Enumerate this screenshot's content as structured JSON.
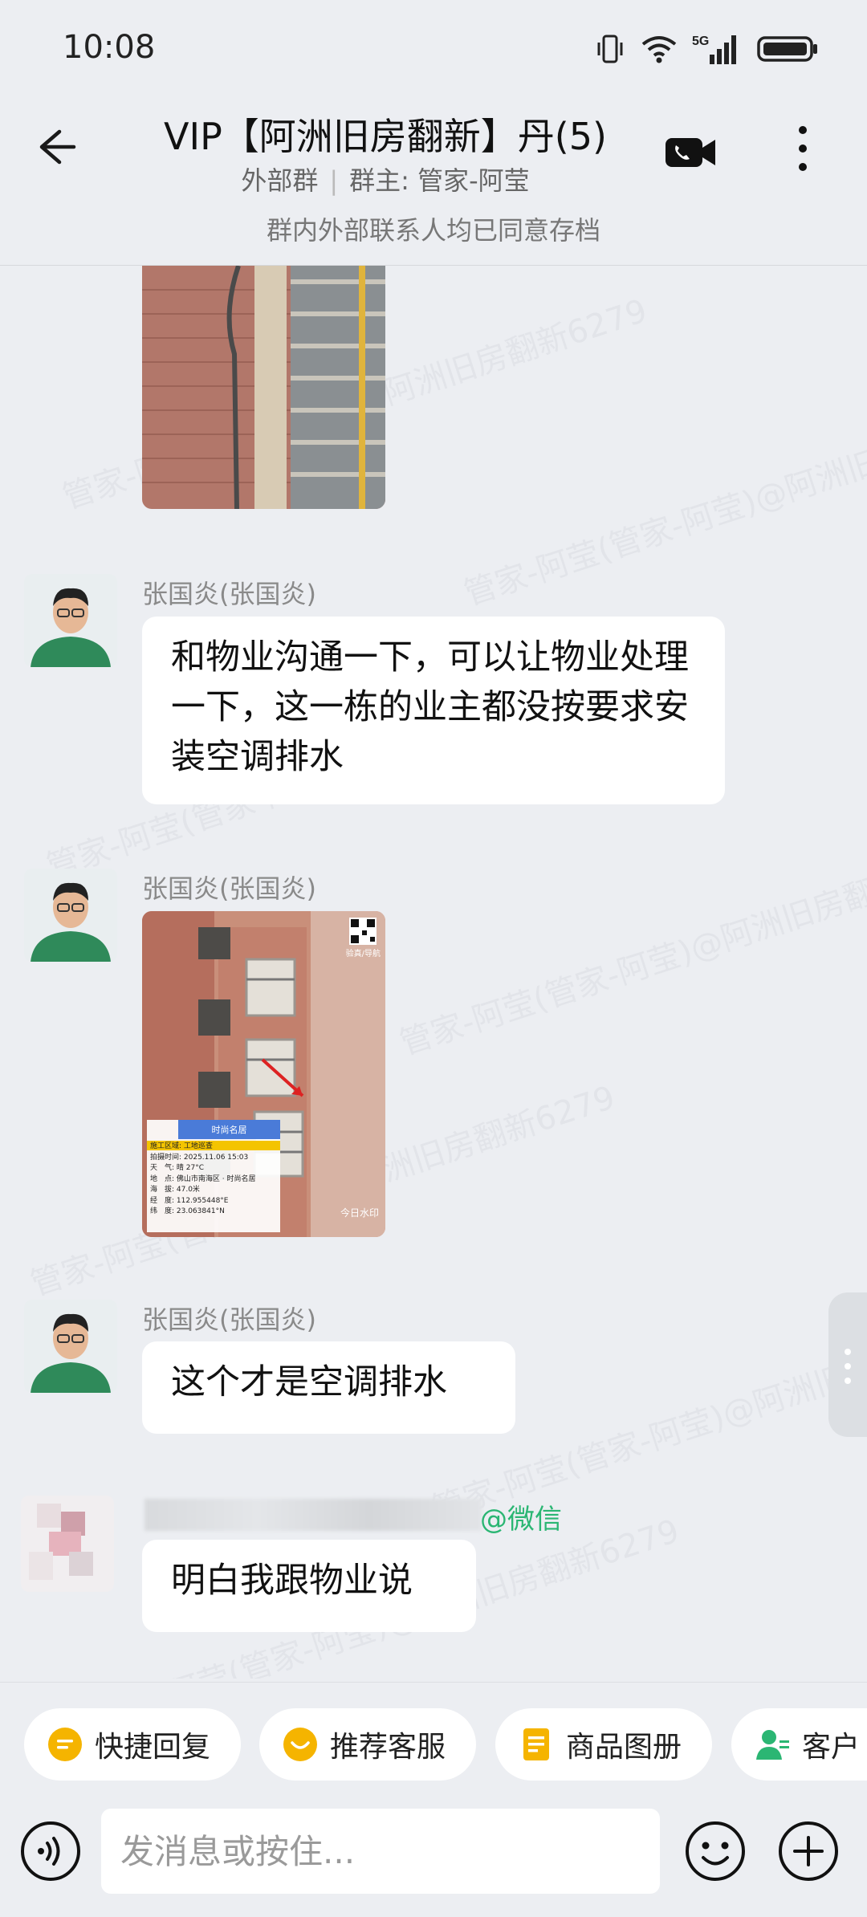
{
  "status": {
    "time": "10:08",
    "network": "5G"
  },
  "header": {
    "title": "VIP【阿洲旧房翻新】丹(5)",
    "group_type": "外部群",
    "owner": "群主: 管家-阿莹"
  },
  "notice": "群内外部联系人均已同意存档",
  "watermark_text": "管家-阿莹(管家-阿莹)@阿洲旧房翻新6279",
  "messages": [
    {
      "sender": "张国炎(张国炎)",
      "text": "和物业沟通一下，可以让物业处理一下，这一栋的业主都没按要求安装空调排水"
    },
    {
      "sender": "张国炎(张国炎)",
      "photo_caption": "时尚名居",
      "photo_info": [
        "施工区域: 工地巡查",
        "拍摄时间: 2025.11.06 15:03",
        "天　气: 晴 27°C",
        "地　点: 佛山市南海区 · 时尚名居",
        "海　拔: 47.0米",
        "经　度: 112.955448°E",
        "纬　度: 23.063841°N"
      ],
      "photo_badge": "今日水印",
      "qr_label": "验真/导航"
    },
    {
      "sender": "张国炎(张国炎)",
      "text": "这个才是空调排水"
    },
    {
      "sender_suffix": "@微信",
      "text": "明白我跟物业说"
    }
  ],
  "quick_replies": [
    {
      "label": "快捷回复",
      "icon": "reply-icon"
    },
    {
      "label": "推荐客服",
      "icon": "service-icon"
    },
    {
      "label": "商品图册",
      "icon": "catalog-icon"
    },
    {
      "label": "客户",
      "icon": "customer-icon"
    }
  ],
  "input": {
    "placeholder": "发消息或按住..."
  },
  "colors": {
    "background": "#eceef2",
    "bubble": "#ffffff",
    "accent_green": "#2bb673",
    "chip_yellow": "#f5b400"
  }
}
